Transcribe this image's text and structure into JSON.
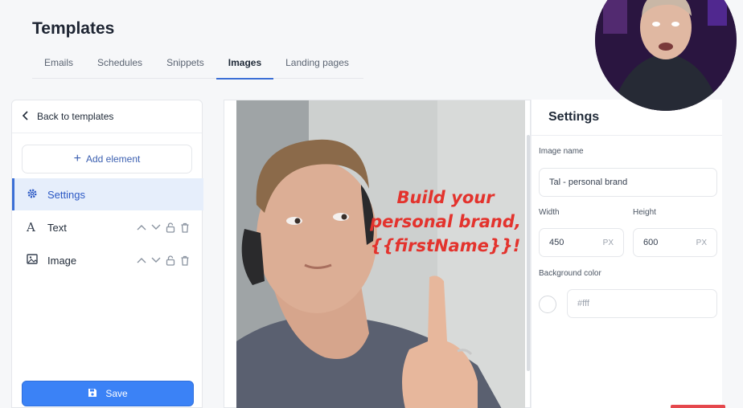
{
  "page": {
    "title": "Templates"
  },
  "tabs": [
    {
      "label": "Emails",
      "active": false
    },
    {
      "label": "Schedules",
      "active": false
    },
    {
      "label": "Snippets",
      "active": false
    },
    {
      "label": "Images",
      "active": true
    },
    {
      "label": "Landing pages",
      "active": false
    }
  ],
  "sidebar": {
    "back_label": "Back to templates",
    "add_element_label": "Add element",
    "elements": [
      {
        "label": "Settings",
        "icon": "gear-icon",
        "active": true
      },
      {
        "label": "Text",
        "icon": "text-icon",
        "active": false
      },
      {
        "label": "Image",
        "icon": "image-icon",
        "active": false
      }
    ],
    "save_label": "Save"
  },
  "canvas": {
    "overlay_lines": [
      "Build your",
      "personal brand,",
      "{{firstName}}!"
    ],
    "overlay_color": "#e3332d"
  },
  "settings": {
    "title": "Settings",
    "image_name_label": "Image name",
    "image_name_value": "Tal - personal brand",
    "width_label": "Width",
    "width_value": "450",
    "height_label": "Height",
    "height_value": "600",
    "unit": "PX",
    "bg_color_label": "Background color",
    "bg_color_placeholder": "#fff"
  },
  "colors": {
    "accent": "#3b82f6",
    "active_bg": "#e6eefb",
    "overlay_text": "#e3332d"
  }
}
